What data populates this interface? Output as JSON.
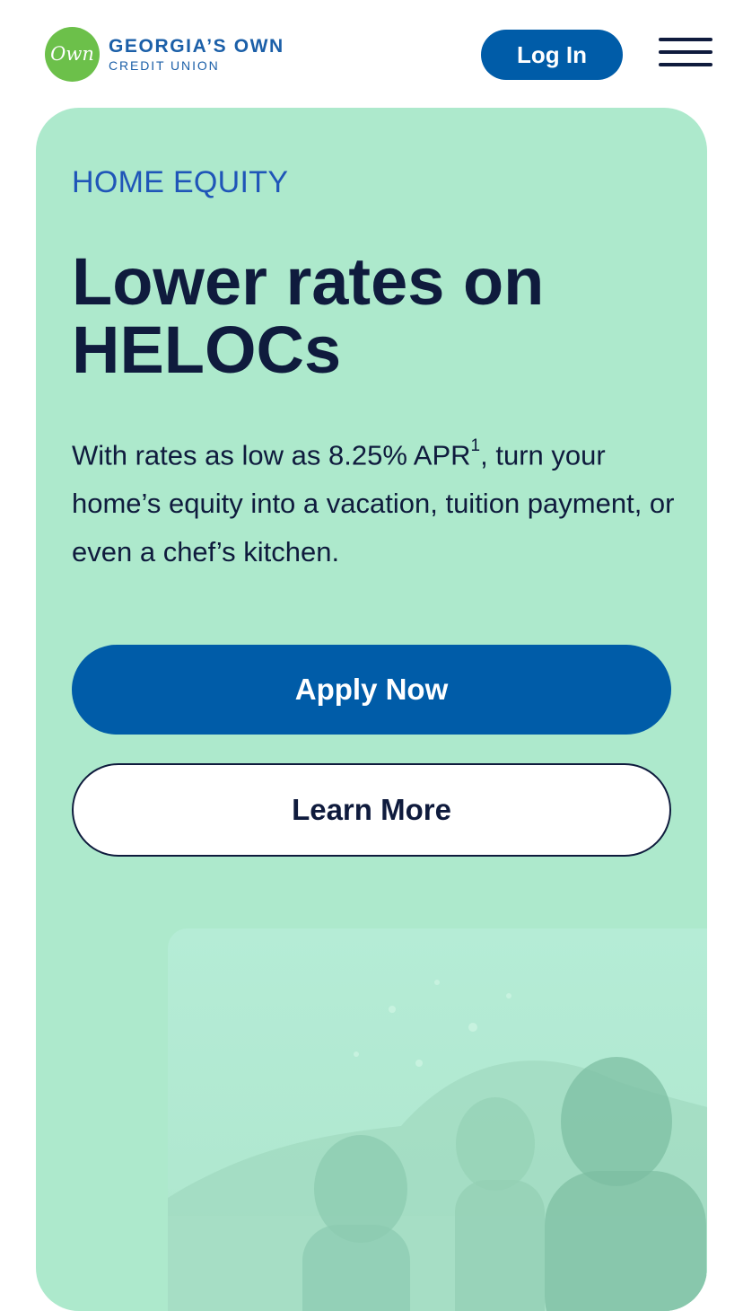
{
  "header": {
    "logo": {
      "badge_text": "Own",
      "name_line1": "GEORGIA’S OWN",
      "name_line2": "CREDIT UNION"
    },
    "login_label": "Log In",
    "menu_icon": "hamburger-menu-icon"
  },
  "hero": {
    "eyebrow": "HOME EQUITY",
    "headline": "Lower rates on HELOCs",
    "body_before": "With rates as low as 8.25% APR",
    "footnote": "1",
    "body_after": ", turn your home’s equity into a vacation, tuition payment, or even a chef’s kitchen.",
    "apply_label": "Apply Now",
    "learn_label": "Learn More",
    "photo_icon": "family-splashing-photo"
  },
  "colors": {
    "brand_blue": "#005ca8",
    "brand_green": "#6cc04a",
    "card_mint": "#ade9cc",
    "text_navy": "#0f1b3d",
    "eyebrow_blue": "#1f55b8"
  }
}
